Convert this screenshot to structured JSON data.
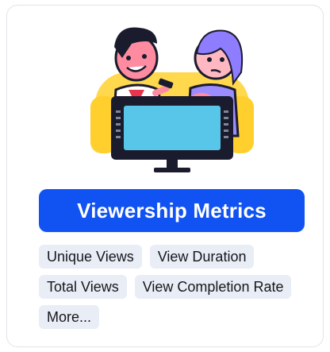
{
  "card": {
    "button_label": "Viewership Metrics",
    "illustration_icon": "couple-watching-tv-illustration",
    "tags": [
      "Unique Views",
      "View Duration",
      "Total Views",
      "View Completion Rate",
      "More..."
    ]
  },
  "colors": {
    "button_bg": "#1153f2",
    "button_text": "#ffffff",
    "tag_bg": "#e9edf6",
    "couch": "#ffd84d",
    "tv_screen": "#58c6e8"
  }
}
